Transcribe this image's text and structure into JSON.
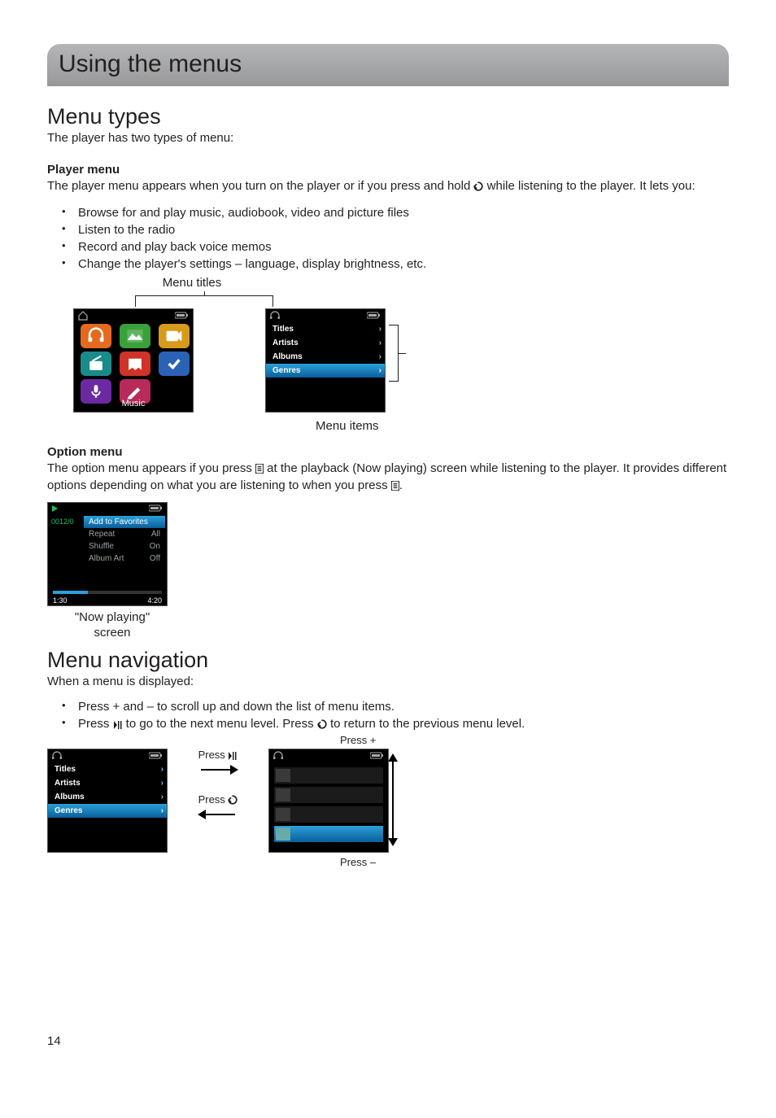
{
  "title": "Using the menus",
  "section1_heading": "Menu types",
  "section1_sub": "The player has two types of menu:",
  "player_menu_heading": "Player menu",
  "player_menu_text_a": "The player menu appears when you turn on the player or if you press and hold ",
  "player_menu_text_b": " while listening to the player. It lets you:",
  "bullets1": [
    "Browse for and play music, audiobook, video and picture files",
    "Listen to the radio",
    "Record and play back voice memos",
    "Change the player's settings – language, display brightness, etc."
  ],
  "fig_menu_titles": "Menu titles",
  "fig_menu_items": "Menu items",
  "home_label": "Music",
  "list_items": [
    "Titles",
    "Artists",
    "Albums",
    "Genres"
  ],
  "option_menu_heading": "Option menu",
  "option_menu_text_a": "The option menu appears if you press ",
  "option_menu_text_b": " at the playback (Now playing) screen while listening to the player. It provides different options depending on what you are listening to when you press ",
  "option_menu_text_c": ".",
  "opt_track_index": "0012/0",
  "opt_rows": [
    {
      "l": "Add to Favorites",
      "r": ""
    },
    {
      "l": "Repeat",
      "r": "All"
    },
    {
      "l": "Shuffle",
      "r": "On"
    },
    {
      "l": "Album Art",
      "r": "Off"
    }
  ],
  "opt_time_l": "1:30",
  "opt_time_r": "4:20",
  "opt_caption_l1": "\"Now playing\"",
  "opt_caption_l2": "screen",
  "nav_heading": "Menu navigation",
  "nav_sub": "When a menu is displayed:",
  "bullets2_a": "Press + and – to scroll up and down the list of menu items.",
  "bullets2_b_a": "Press ",
  "bullets2_b_b": " to go to the next menu level. Press ",
  "bullets2_b_c": " to return to the previous menu level.",
  "press_play_lbl": "Press ",
  "press_back_lbl": "Press ",
  "press_plus_lbl": "Press +",
  "press_minus_lbl": "Press –",
  "page_number": "14"
}
